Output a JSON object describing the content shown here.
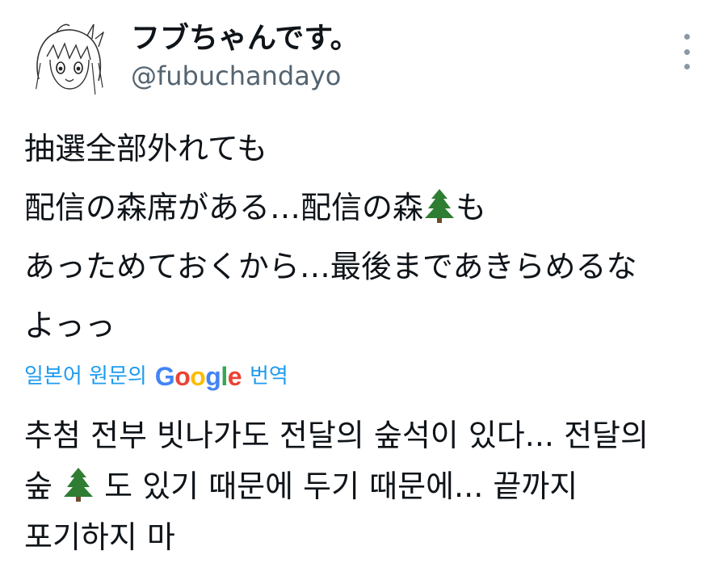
{
  "author": {
    "display_name": "フブちゃんです。",
    "handle": "@fubuchandayo",
    "avatar_icon": "avatar-sketch-icon"
  },
  "menu": {
    "icon": "more-vertical-icon"
  },
  "tweet": {
    "lines": [
      "抽選全部外れても",
      "配信の森席がある…配信の森",
      "も",
      "あっためておくから…最後まであきらめるな",
      "よっっ"
    ],
    "emoji": "evergreen-tree-icon"
  },
  "translation": {
    "prefix": "일본어 원문의",
    "provider_letters": [
      "G",
      "o",
      "o",
      "g",
      "l",
      "e"
    ],
    "provider_colors": [
      "#4285F4",
      "#EA4335",
      "#FBBC05",
      "#4285F4",
      "#34A853",
      "#EA4335"
    ],
    "suffix": "번역",
    "link_color": "#1d9bf0",
    "lines": [
      "추첨 전부 빗나가도 전달의 숲석이 있다... 전달의",
      "숲",
      "도 있기 때문에 두기 때문에... 끝까지",
      "포기하지 마"
    ]
  }
}
